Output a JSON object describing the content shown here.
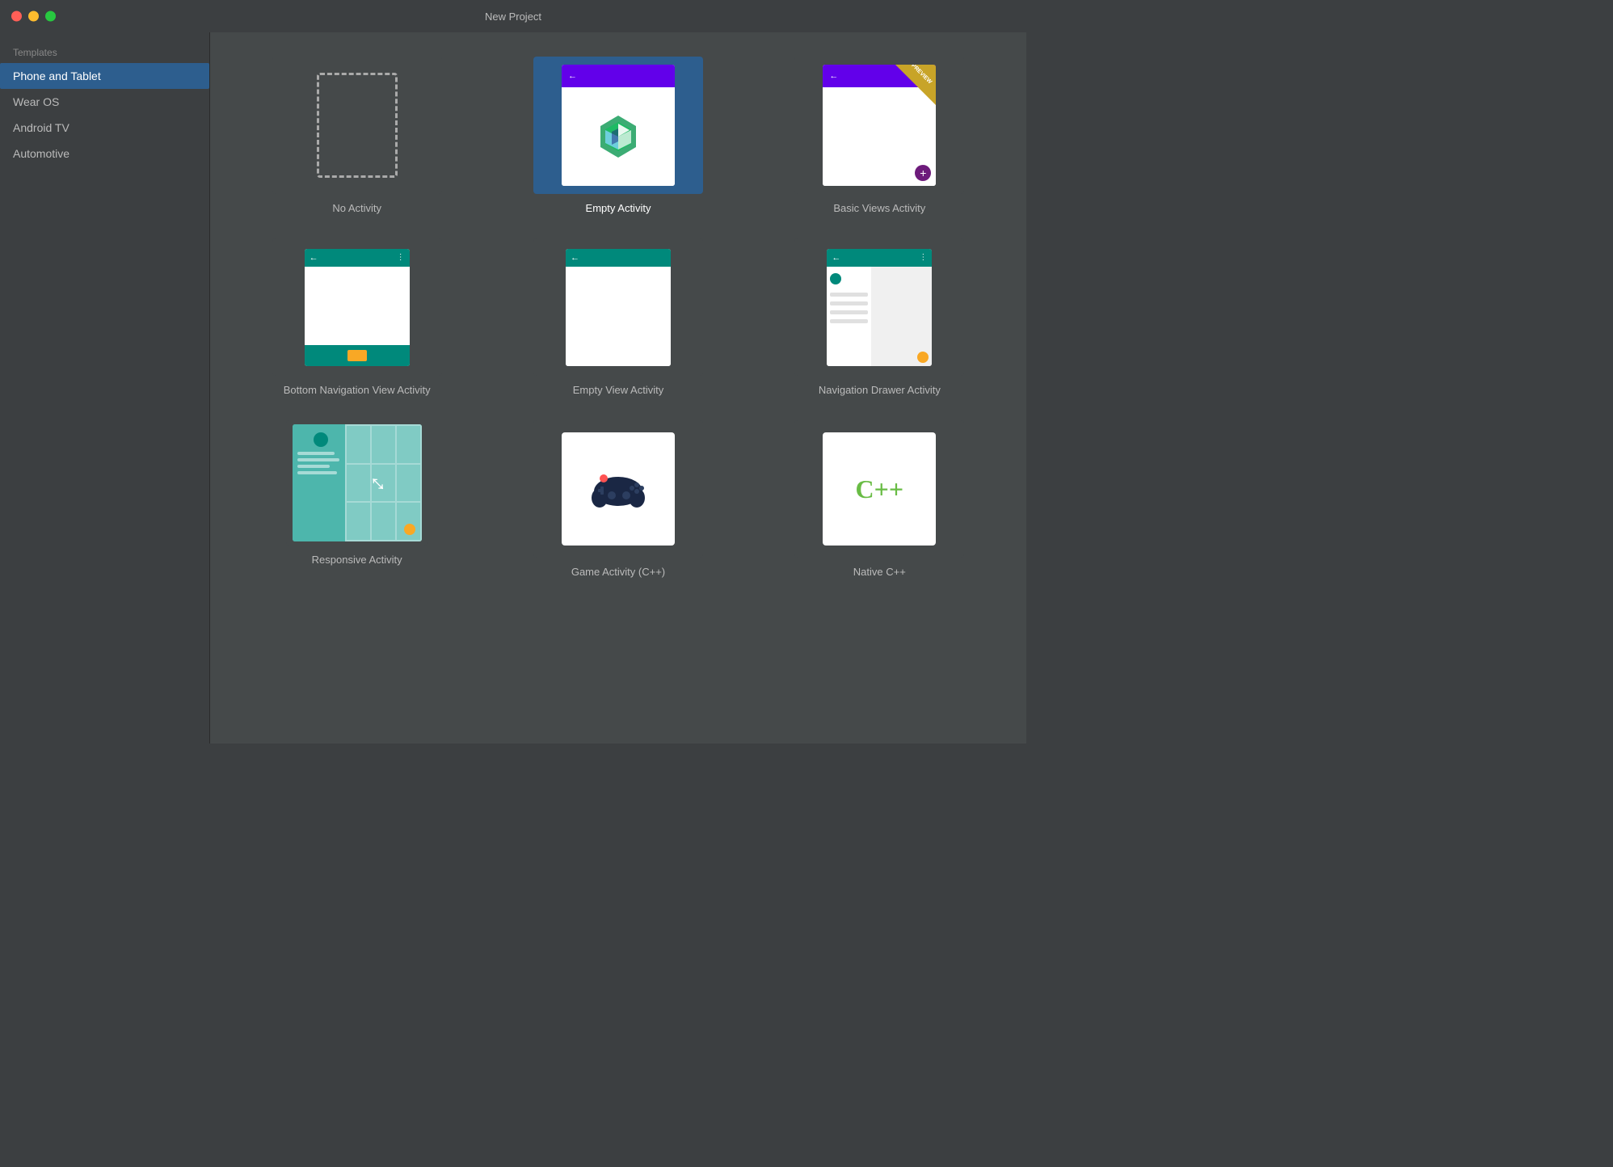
{
  "window": {
    "title": "New Project",
    "controls": {
      "close": "close",
      "minimize": "minimize",
      "maximize": "maximize"
    }
  },
  "sidebar": {
    "section_label": "Templates",
    "items": [
      {
        "id": "phone-tablet",
        "label": "Phone and Tablet",
        "active": true
      },
      {
        "id": "wear-os",
        "label": "Wear OS",
        "active": false
      },
      {
        "id": "android-tv",
        "label": "Android TV",
        "active": false
      },
      {
        "id": "automotive",
        "label": "Automotive",
        "active": false
      }
    ]
  },
  "templates": {
    "items": [
      {
        "id": "no-activity",
        "label": "No Activity",
        "selected": false
      },
      {
        "id": "empty-activity",
        "label": "Empty Activity",
        "selected": true
      },
      {
        "id": "basic-views-activity",
        "label": "Basic Views Activity",
        "selected": false
      },
      {
        "id": "bottom-navigation",
        "label": "Bottom Navigation View Activity",
        "selected": false
      },
      {
        "id": "empty-view",
        "label": "Empty View Activity",
        "selected": false
      },
      {
        "id": "navigation-drawer",
        "label": "Navigation Drawer Activity",
        "selected": false
      },
      {
        "id": "responsive",
        "label": "Responsive Activity",
        "selected": false
      },
      {
        "id": "game-activity",
        "label": "Game Activity (C++)",
        "selected": false
      },
      {
        "id": "native-cpp",
        "label": "Native C++",
        "selected": false
      }
    ]
  }
}
